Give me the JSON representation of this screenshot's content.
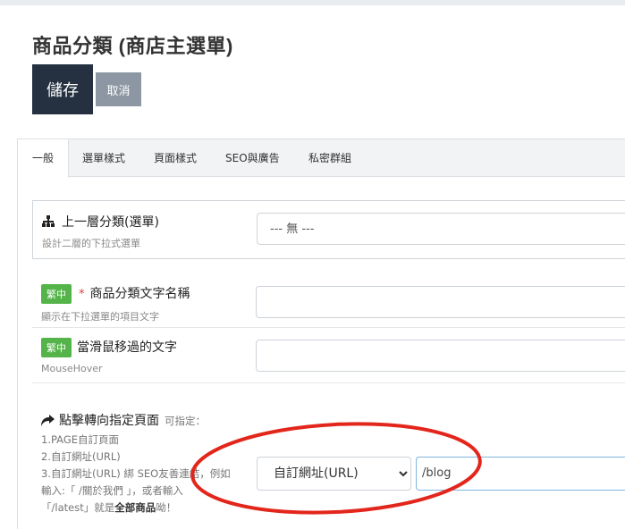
{
  "page": {
    "title": "商品分類 (商店主選單)"
  },
  "actions": {
    "save_label": "儲存",
    "cancel_label": "取消"
  },
  "tabs": [
    {
      "label": "一般",
      "active": true
    },
    {
      "label": "選單樣式",
      "active": false
    },
    {
      "label": "頁面樣式",
      "active": false
    },
    {
      "label": "SEO與廣告",
      "active": false
    },
    {
      "label": "私密群組",
      "active": false
    }
  ],
  "parent_category": {
    "label": "上一層分類(選單)",
    "hint": "設計二層的下拉式選單",
    "value": "--- 無 ---",
    "icon": "sitemap-icon"
  },
  "category_name": {
    "badge": "繁中",
    "required_mark": "*",
    "label": "商品分類文字名稱",
    "hint": "顯示在下拉選單的項目文字",
    "value": ""
  },
  "hover_text": {
    "badge": "繁中",
    "label": "當滑鼠移過的文字",
    "hint": "MouseHover",
    "value": ""
  },
  "redirect": {
    "icon": "share-arrow-icon",
    "label": "點擊轉向指定頁面",
    "label_suffix": "可指定：",
    "help_lines": [
      "1.PAGE自訂頁面",
      "2.自訂網址(URL)",
      "3.自訂網址(URL) 綁 SEO友善連結，例如",
      "輸入:「 /關於我們 」，或者輸入",
      "「/latest」就是"
    ],
    "help_bold": "全部商品",
    "help_tail": "呦！",
    "type_value": "自訂網址(URL)",
    "type_options": [
      "自訂網址(URL)"
    ],
    "url_value": "/blog"
  },
  "annotation": {
    "color": "#e3261c"
  },
  "colors": {
    "save_bg": "#253141",
    "cancel_bg": "#8c97a3",
    "badge_bg": "#54b449"
  }
}
